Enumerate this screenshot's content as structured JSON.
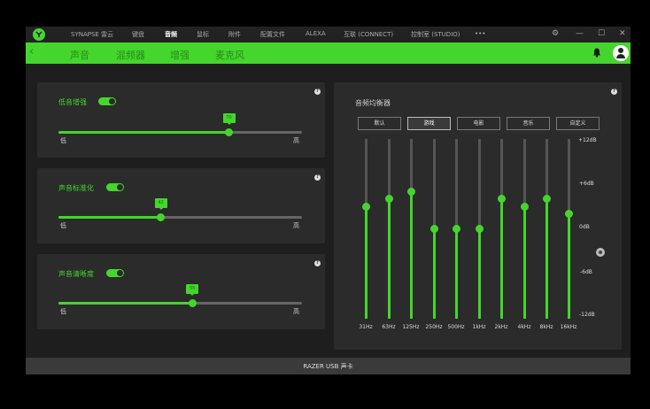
{
  "app": {
    "nav": [
      "SYNAPSE 雷云",
      "键盘",
      "音频",
      "鼠标",
      "附件",
      "配置文件",
      "ALEXA",
      "互联 (CONNECT)",
      "控制室 (STUDIO)",
      "•••"
    ],
    "active_nav": "音频",
    "window_controls": [
      "⚙",
      "—",
      "☐",
      "✕"
    ]
  },
  "subnav": {
    "tabs": [
      "声音",
      "混频器",
      "增强",
      "麦克风"
    ],
    "active_tab": "增强"
  },
  "bass_boost": {
    "title": "低音增强",
    "enabled": true,
    "value": 70,
    "value_label": "70",
    "min_label": "低",
    "max_label": "高"
  },
  "sound_norm": {
    "title": "声音标准化",
    "enabled": true,
    "value": 42,
    "value_label": "42",
    "min_label": "低",
    "max_label": "高"
  },
  "voice_clarity": {
    "title": "声音清晰度",
    "enabled": true,
    "value": 55,
    "value_label": "55",
    "min_label": "低",
    "max_label": "高"
  },
  "equalizer": {
    "title": "音频均衡器",
    "presets": [
      "默认",
      "游戏",
      "电影",
      "音乐",
      "自定义"
    ],
    "active_preset": "游戏",
    "db_labels": [
      "+12dB",
      "+6dB",
      "0dB",
      "-6dB",
      "-12dB"
    ],
    "bands": [
      {
        "freq": "31Hz",
        "db": 3
      },
      {
        "freq": "63Hz",
        "db": 4
      },
      {
        "freq": "125Hz",
        "db": 5
      },
      {
        "freq": "250Hz",
        "db": 0
      },
      {
        "freq": "500Hz",
        "db": 0
      },
      {
        "freq": "1kHz",
        "db": 0
      },
      {
        "freq": "2kHz",
        "db": 4
      },
      {
        "freq": "4kHz",
        "db": 3
      },
      {
        "freq": "8kHz",
        "db": 4
      },
      {
        "freq": "16kHz",
        "db": 2
      }
    ]
  },
  "status_bar": {
    "device": "RAZER USB 声卡"
  },
  "colors": {
    "accent": "#44d62c",
    "panel": "#2b2b2b",
    "background": "#1e1e1e"
  }
}
